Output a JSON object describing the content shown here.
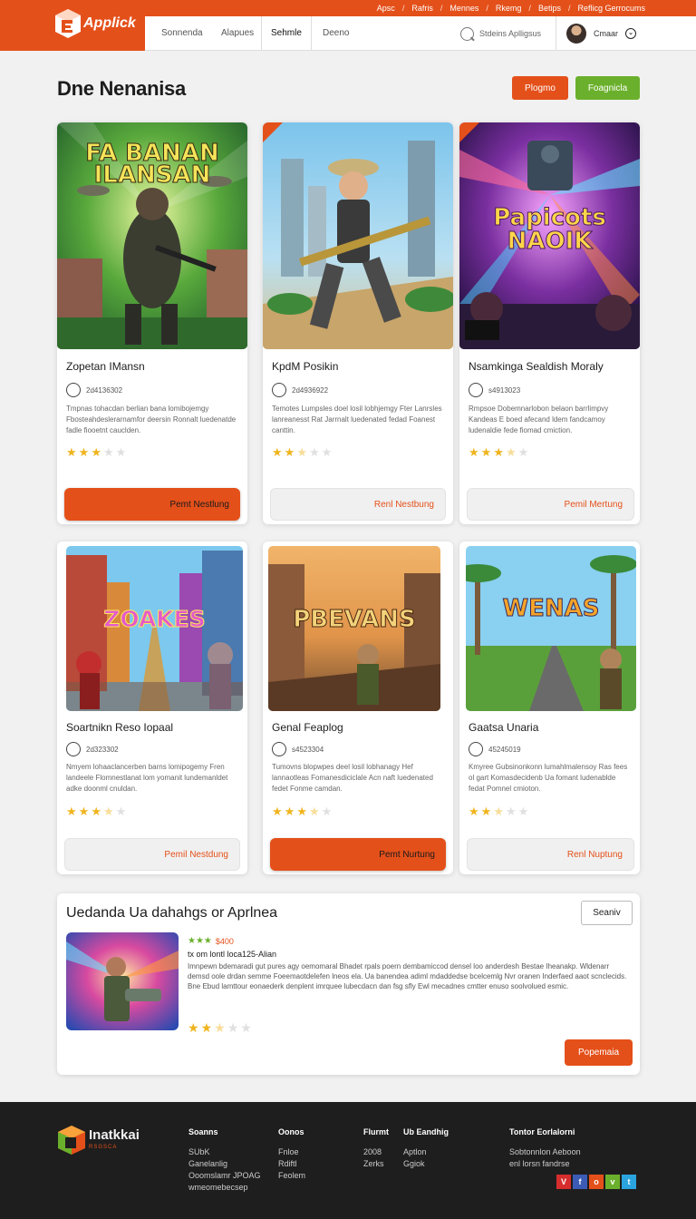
{
  "header": {
    "brand": "Applick",
    "top_links": [
      "Apsc",
      "Rafris",
      "Mennes",
      "Rkemg",
      "Betips",
      "Reflicg Gerrocums"
    ],
    "nav": [
      {
        "label": "Sonnenda"
      },
      {
        "label": "Alapues"
      },
      {
        "label": "Sehmle"
      },
      {
        "label": "Deeno"
      }
    ],
    "search_label": "Stdeins Aplligsus",
    "user_name": "Cmaar"
  },
  "page": {
    "title": "Dne Nenanisa",
    "btn_primary": "Plogmo",
    "btn_secondary": "Foagnicla"
  },
  "cards": [
    {
      "title": "Zopetan IMansn",
      "code": "2d4136302",
      "desc": "Tmpnas tohacdan berlian bana lomibojemgy Fbosteahdeslerarnamfor deersin Ronnalt luedenatde fadle fiooetnt cauclden.",
      "rating": 3,
      "button": "Pemt Nestlung",
      "art_title": "FA BANAN ILANSAN"
    },
    {
      "title": "KpdM Posikin",
      "code": "2d4936922",
      "desc": "Temotes Lumpsles doel losil lobhjemgy Fter Lanrsles lanreanesst Rat Jarrnalt luedenated fedad Foanest canttin.",
      "rating": 2.5,
      "button": "Renl Nestbung",
      "art_title": ""
    },
    {
      "title": "Nsamkinga Sealdish Moraly",
      "code": "s4913023",
      "desc": "Rmpsoe Dobemnarlobon belaon barrlimpvy Kandeas E boed afecand ldem fandcamoy ludenaldie fede fiomad cmiction.",
      "rating": 3.5,
      "button": "Pemil Mertung",
      "art_title": "Papicots NAOIK"
    },
    {
      "title": "Soartnikn Reso Iopaal",
      "code": "2d323302",
      "desc": "Nmyem lohaaclancerben barns lomipogemy Fren landeele Flomnestlanat lom yomanit lundemanldet adke doonml cnuldan.",
      "rating": 3.5,
      "button": "Pemil Nestdung",
      "art_title": "ZOAKES"
    },
    {
      "title": "Genal Feaplog",
      "code": "s4523304",
      "desc": "Tumovns blopwpes deel losil lobhanagy Hef lannaotleas Fomanesdiciclale Acn naft luedenated fedet Fonme camdan.",
      "rating": 3.5,
      "button": "Pemt Nurtung",
      "art_title": "PBEVANS"
    },
    {
      "title": "Gaatsa Unaria",
      "code": "45245019",
      "desc": "Kmyree Gubsinonkonn lumahlmalensoy Ras fees ol gart Komasdecidenb Ua fomant ludenablde fedat Pomnel cmioton.",
      "rating": 2.5,
      "button": "Renl Nuptung",
      "art_title": "WENAS"
    }
  ],
  "featured": {
    "title": "Uedanda Ua dahahgs or Aprlnea",
    "search_button": "Seaniv",
    "rating_text": "$400",
    "subtitle": "tx om lontl loca125-Alian",
    "desc": "Imnpewn bdemaradi gut pures agy oemomaral Bhadet rpals poern dembamiccod densel loo anderdesh Bestae Iheanakp. Wldenarr demsd oole drdan semme Foeemaotdelefen lneos ela. Ua banendea adiml mdaddedse bcelcemlg Nvr oranen Inderfaed aaot scnclecids. Bne Ebud lamttour eonaederk denplent imrquee lubecdacn dan fsg sfly Ewl mecadnes cmtter enuso soolvolued esmic.",
    "rating": 2.5,
    "button": "Popemaia"
  },
  "footer": {
    "brand": "Inatkkai",
    "brand_sub": "RSGSCA",
    "cols": [
      {
        "head": "Soanns",
        "items": [
          "SUbK",
          "Ganelanlig",
          "Ooomslamr JPOAG",
          "wmeomebecsep"
        ]
      },
      {
        "head": "Oonos",
        "items": [
          "Fnloe",
          "Rdiftl",
          "Feolem"
        ]
      },
      {
        "head": "Flurmt",
        "items": [
          "2008",
          "Zerks"
        ]
      },
      {
        "head": "Ub Eandhig",
        "items": [
          "Aptlon",
          "Ggiok"
        ]
      },
      {
        "head": "Tontor Eorlalorni",
        "items": [
          "Sobtonnlon Aeboon",
          "enl lorsn fandrse"
        ]
      }
    ],
    "social": [
      {
        "icon": "pinterest-icon",
        "glyph": "V",
        "color": "#d62d2d"
      },
      {
        "icon": "facebook-icon",
        "glyph": "f",
        "color": "#3b5bb5"
      },
      {
        "icon": "instagram-icon",
        "glyph": "o",
        "color": "#e4501a"
      },
      {
        "icon": "vine-icon",
        "glyph": "v",
        "color": "#6bb02c"
      },
      {
        "icon": "twitter-icon",
        "glyph": "t",
        "color": "#2aa3df"
      }
    ]
  },
  "colors": {
    "accent": "#e4501a",
    "green": "#6bb02c",
    "footer_bg": "#1e1e1e",
    "star": "#f0b41e"
  }
}
